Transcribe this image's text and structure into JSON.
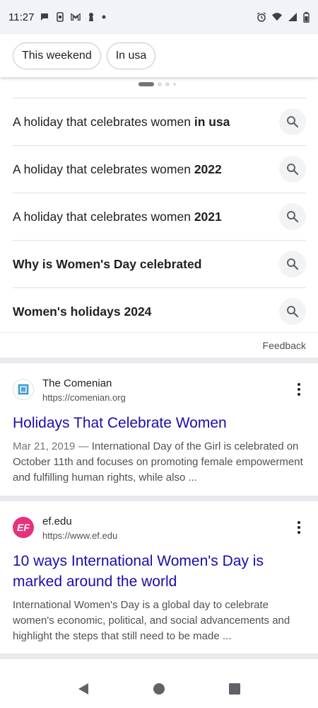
{
  "status_bar": {
    "time": "11:27",
    "left_icons": [
      "chat-bubble-icon",
      "phone-file-icon",
      "gmail-icon",
      "keyhole-icon",
      "dot-icon"
    ],
    "right_icons": [
      "alarm-icon",
      "wifi-icon",
      "signal-icon",
      "battery-icon"
    ]
  },
  "chips": [
    {
      "label": "This weekend"
    },
    {
      "label": "In usa"
    }
  ],
  "suggestions": [
    {
      "normal": "A holiday that celebrates women ",
      "bold": "in usa"
    },
    {
      "normal": "A holiday that celebrates women ",
      "bold": "2022"
    },
    {
      "normal": "A holiday that celebrates women ",
      "bold": "2021"
    },
    {
      "normal": "",
      "bold": "Why is Women's Day celebrated"
    },
    {
      "normal": "",
      "bold": "Women's holidays 2024"
    }
  ],
  "feedback": {
    "label": "Feedback"
  },
  "results": [
    {
      "site_name": "The Comenian",
      "url": "https://comenian.org",
      "title": "Holidays That Celebrate Women",
      "date": "Mar 21, 2019 —",
      "snippet": " International Day of the Girl is celebrated on October 11th and focuses on promoting female empowerment and fulfilling human rights, while also ..."
    },
    {
      "site_name": "ef.edu",
      "url": "https://www.ef.edu",
      "favicon_text": "EF",
      "title": "10 ways International Women's Day is marked around the world",
      "date": "",
      "snippet": "International Women's Day is a global day to celebrate women's economic, political, and social advancements and highlight the steps that still need to be made ..."
    }
  ],
  "nav": [
    "back-icon",
    "home-icon",
    "recents-icon"
  ],
  "colors": {
    "link": "#1a0dab",
    "ef_brand": "#e6327d"
  }
}
